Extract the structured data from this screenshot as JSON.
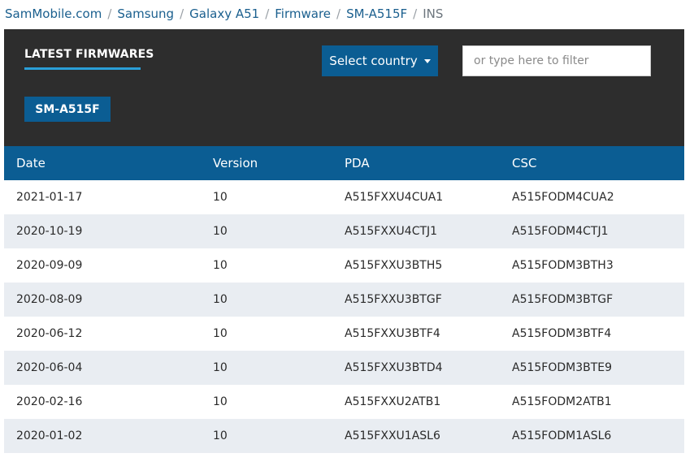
{
  "breadcrumb": {
    "items": [
      "SamMobile.com",
      "Samsung",
      "Galaxy A51",
      "Firmware",
      "SM-A515F"
    ],
    "separator": "/",
    "current": "INS"
  },
  "panel": {
    "title": "LATEST FIRMWARES",
    "country_button": "Select country",
    "filter_placeholder": "or type here to filter",
    "model_tag": "SM-A515F"
  },
  "table": {
    "headers": {
      "date": "Date",
      "version": "Version",
      "pda": "PDA",
      "csc": "CSC"
    },
    "rows": [
      {
        "date": "2021-01-17",
        "version": "10",
        "pda": "A515FXXU4CUA1",
        "csc": "A515FODM4CUA2"
      },
      {
        "date": "2020-10-19",
        "version": "10",
        "pda": "A515FXXU4CTJ1",
        "csc": "A515FODM4CTJ1"
      },
      {
        "date": "2020-09-09",
        "version": "10",
        "pda": "A515FXXU3BTH5",
        "csc": "A515FODM3BTH3"
      },
      {
        "date": "2020-08-09",
        "version": "10",
        "pda": "A515FXXU3BTGF",
        "csc": "A515FODM3BTGF"
      },
      {
        "date": "2020-06-12",
        "version": "10",
        "pda": "A515FXXU3BTF4",
        "csc": "A515FODM3BTF4"
      },
      {
        "date": "2020-06-04",
        "version": "10",
        "pda": "A515FXXU3BTD4",
        "csc": "A515FODM3BTE9"
      },
      {
        "date": "2020-02-16",
        "version": "10",
        "pda": "A515FXXU2ATB1",
        "csc": "A515FODM2ATB1"
      },
      {
        "date": "2020-01-02",
        "version": "10",
        "pda": "A515FXXU1ASL6",
        "csc": "A515FODM1ASL6"
      }
    ]
  },
  "colors": {
    "accent": "#0b5d93",
    "panel_bg": "#2d2d2d",
    "underline": "#2a9fd8",
    "stripe": "#e9edf2",
    "link": "#1a5f8e"
  },
  "icons": {
    "dropdown": "caret-down-icon"
  }
}
